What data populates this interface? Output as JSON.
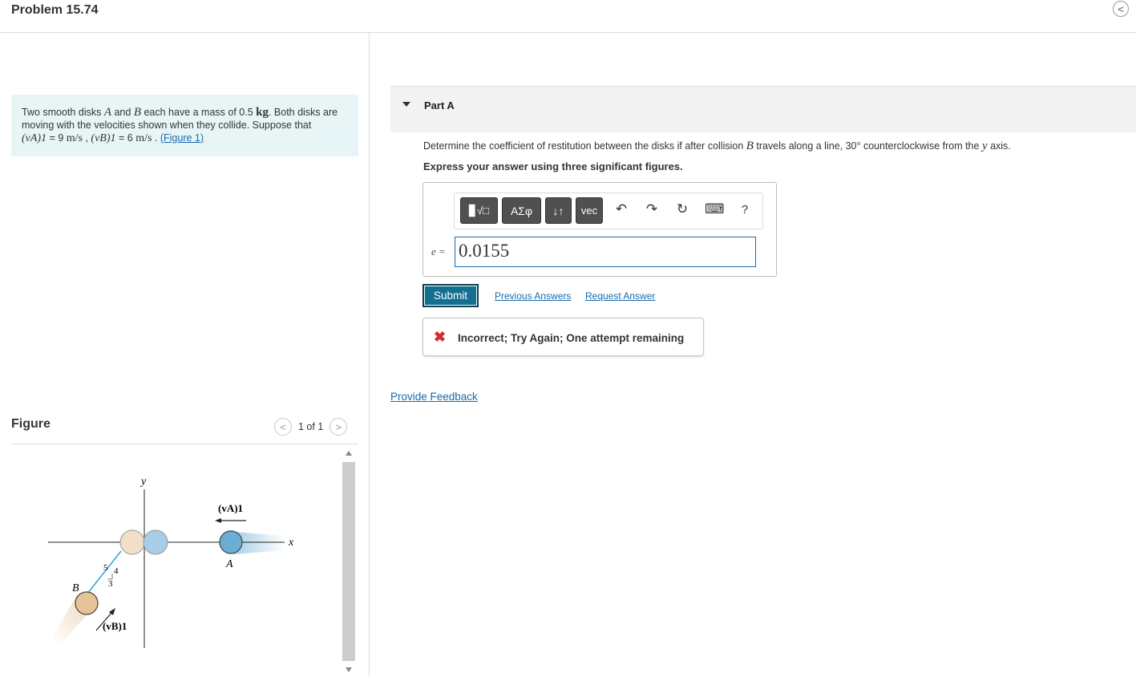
{
  "header": {
    "title": "Problem 15.74",
    "collapse_icon": "chevron-left-icon",
    "collapse_glyph": "<"
  },
  "intro": {
    "text_1": "Two smooth disks ",
    "var_a": "A",
    "text_2": " and ",
    "var_b": "B",
    "text_3": " each have a mass of 0.5 ",
    "unit_kg": "kg",
    "text_4": ". Both disks are moving with the velocities shown when they collide. Suppose that",
    "eq_va": "(vA)1",
    "eq_va_value": " = 9 ",
    "unit_ms_1": "m/s",
    "sep": " , ",
    "eq_vb": "(vB)1",
    "eq_vb_value": " = 6 ",
    "unit_ms_2": "m/s",
    "dot": " . ",
    "figure_link": "(Figure 1)"
  },
  "figure": {
    "label": "Figure",
    "pager": "1 of 1",
    "prev_glyph": "<",
    "next_glyph": ">",
    "labels": {
      "y": "y",
      "x": "x",
      "va": "(vA)1",
      "vb": "(vB)1",
      "a": "A",
      "b": "B",
      "r5": "5",
      "r4": "4",
      "r3": "3"
    },
    "colors": {
      "disk_a": "#6aaed6",
      "disk_b": "#e8c39a",
      "ghost_b": "#f1dfc7",
      "line": "#2aa3dc"
    }
  },
  "part_a": {
    "title": "Part A",
    "question_1": "Determine the coefficient of restitution between the disks if after collision ",
    "question_var": "B",
    "question_2": " travels along a line, 30° counterclockwise from the ",
    "question_var_y": "y",
    "question_3": " axis.",
    "instruction": "Express your answer using three significant figures.",
    "toolbar": {
      "templates_label": "▊√□",
      "greek_label": "ΑΣφ",
      "arrows_label": "↓↑",
      "vec_label": "vec",
      "undo_glyph": "↶",
      "redo_glyph": "↷",
      "reset_glyph": "↻",
      "keyboard_glyph": "⌨",
      "help_glyph": "?"
    },
    "answer_label": "e =",
    "answer_value": "0.0155",
    "submit_label": "Submit",
    "previous_answers": "Previous Answers",
    "request_answer": "Request Answer",
    "feedback_glyph": "✖",
    "feedback": "Incorrect; Try Again; One attempt remaining"
  },
  "provide_feedback": "Provide Feedback"
}
